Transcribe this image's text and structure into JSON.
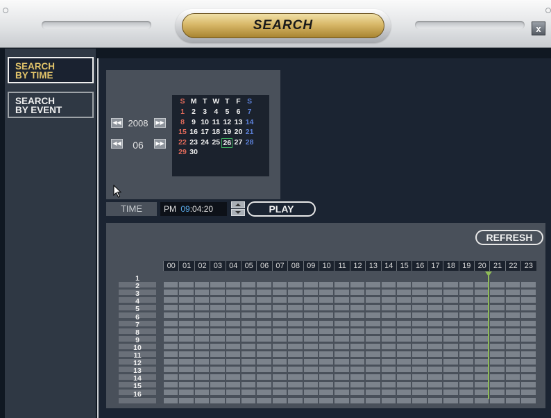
{
  "window": {
    "title": "SEARCH",
    "close_label": "x"
  },
  "sidebar": {
    "items": [
      {
        "label": "SEARCH\nBY TIME",
        "active": true
      },
      {
        "label": "SEARCH\nBY EVENT",
        "active": false
      }
    ]
  },
  "calendar": {
    "year": "2008",
    "month": "06",
    "weekday_headers": [
      "S",
      "M",
      "T",
      "W",
      "T",
      "F",
      "S"
    ],
    "weeks": [
      [
        "",
        "1",
        "2",
        "3",
        "4",
        "5",
        "6",
        "7"
      ],
      [
        "8",
        "9",
        "10",
        "11",
        "12",
        "13",
        "14"
      ],
      [
        "15",
        "16",
        "17",
        "18",
        "19",
        "20",
        "21"
      ],
      [
        "22",
        "23",
        "24",
        "25",
        "26",
        "27",
        "28"
      ],
      [
        "29",
        "30",
        "",
        "",
        "",
        "",
        ""
      ]
    ],
    "selected_day": "26",
    "colors": {
      "sunday": "#e06a5a",
      "saturday": "#5b7fd6",
      "weekday": "#f0f0f0"
    }
  },
  "time": {
    "label": "TIME",
    "ampm": "PM",
    "hour": "09",
    "sep1": ":",
    "minute": "04",
    "sep2": ":",
    "second": "20"
  },
  "buttons": {
    "play": "PLAY",
    "refresh": "REFRESH"
  },
  "timeline": {
    "hours": [
      "00",
      "01",
      "02",
      "03",
      "04",
      "05",
      "06",
      "07",
      "08",
      "09",
      "10",
      "11",
      "12",
      "13",
      "14",
      "15",
      "16",
      "17",
      "18",
      "19",
      "20",
      "21",
      "22",
      "23"
    ],
    "channels": [
      "1",
      "2",
      "3",
      "4",
      "5",
      "6",
      "7",
      "8",
      "9",
      "10",
      "11",
      "12",
      "13",
      "14",
      "15",
      "16"
    ],
    "current_hour_marker": "21"
  }
}
